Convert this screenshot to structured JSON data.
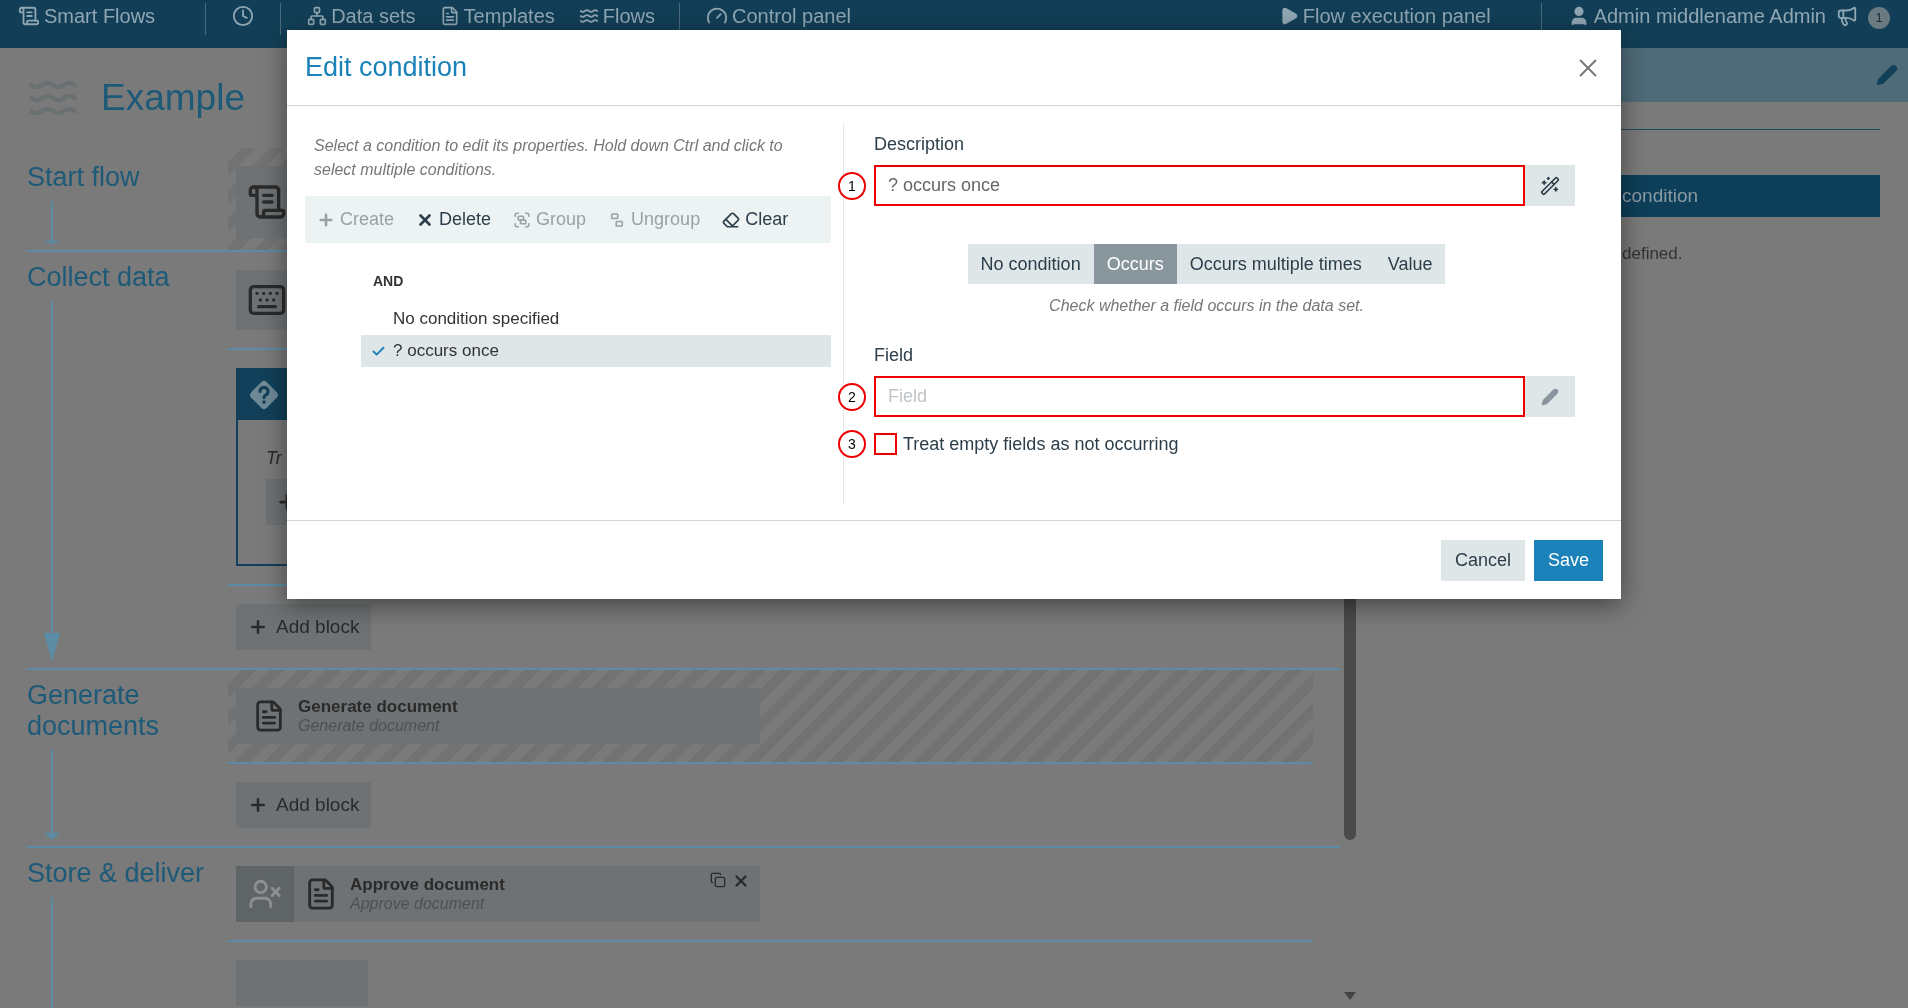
{
  "topbar": {
    "brand": "Smart Flows",
    "nav": [
      {
        "label": "Data sets"
      },
      {
        "label": "Templates"
      },
      {
        "label": "Flows"
      }
    ],
    "control": "Control panel",
    "execution": "Flow execution panel",
    "user": "Admin middlename Admin",
    "notifications": "1"
  },
  "flow": {
    "title": "Example",
    "stages": [
      {
        "label": "Start flow",
        "items": [
          {
            "kind": "start-tile",
            "hatched": true
          }
        ]
      },
      {
        "label": "Collect data",
        "items": [
          {
            "kind": "input-tile",
            "hatched": false
          },
          {
            "kind": "decision",
            "hatched": false,
            "text": "Tr"
          },
          {
            "kind": "add-button",
            "hatched": false,
            "label": "Add block"
          }
        ]
      },
      {
        "label": "Generate documents",
        "items": [
          {
            "kind": "document-card",
            "hatched": true,
            "title": "Generate document",
            "subtitle": "Generate document"
          },
          {
            "kind": "add-button",
            "hatched": false,
            "label": "Add block"
          }
        ]
      },
      {
        "label": "Store & deliver",
        "items": [
          {
            "kind": "approval-card",
            "hatched": false,
            "title": "Approve document",
            "subtitle": "Approve document"
          },
          {
            "kind": "button-stub",
            "hatched": false
          }
        ]
      }
    ]
  },
  "side_panel": {
    "button": "condition",
    "note": "defined."
  },
  "dialog": {
    "title": "Edit condition",
    "hint": "Select a condition to edit its properties. Hold down Ctrl and click to select multiple conditions.",
    "toolbar": [
      {
        "label": "Create",
        "disabled": true
      },
      {
        "label": "Delete",
        "disabled": false
      },
      {
        "label": "Group",
        "disabled": true
      },
      {
        "label": "Ungroup",
        "disabled": true
      },
      {
        "label": "Clear",
        "disabled": false
      }
    ],
    "tree": {
      "operator": "AND",
      "conditions": [
        {
          "label": "No condition specified",
          "selected": false
        },
        {
          "label": "? occurs once",
          "selected": true
        }
      ]
    },
    "description": {
      "label": "Description",
      "value": "? occurs once",
      "marker": "1"
    },
    "condition_types": [
      {
        "label": "No condition",
        "selected": false
      },
      {
        "label": "Occurs",
        "selected": true
      },
      {
        "label": "Occurs multiple times",
        "selected": false
      },
      {
        "label": "Value",
        "selected": false
      }
    ],
    "type_hint": "Check whether a field occurs in the data set.",
    "field": {
      "label": "Field",
      "placeholder": "Field",
      "marker": "2"
    },
    "empty_option": {
      "label": "Treat empty fields as not occurring",
      "checked": false,
      "marker": "3"
    },
    "buttons": [
      {
        "label": "Cancel",
        "kind": "secondary"
      },
      {
        "label": "Save",
        "kind": "primary"
      }
    ]
  }
}
